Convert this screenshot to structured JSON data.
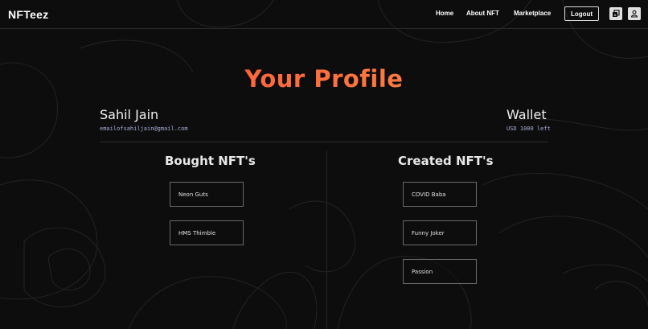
{
  "nav": {
    "brand": "NFTeez",
    "links": [
      "Home",
      "About NFT",
      "Marketplace"
    ],
    "logout_label": "Logout",
    "icons": [
      "gallery-icon",
      "user-icon"
    ]
  },
  "profile": {
    "title": "Your Profile",
    "name": "Sahil Jain",
    "email": "emailofsahiljain@gmail.com"
  },
  "wallet": {
    "title": "Wallet",
    "balance": "USD 1000 left"
  },
  "bought": {
    "heading": "Bought NFT's",
    "items": [
      "Neon Guts",
      "HMS Thimble"
    ]
  },
  "created": {
    "heading": "Created NFT's",
    "items": [
      "COVID Baba",
      "Funny Joker",
      "Passion"
    ]
  },
  "colors": {
    "background": "#0d0d0d",
    "title_gradient_start": "#ff4d3a",
    "title_gradient_end": "#ff9a4d",
    "email_text": "#a8b0d8"
  }
}
